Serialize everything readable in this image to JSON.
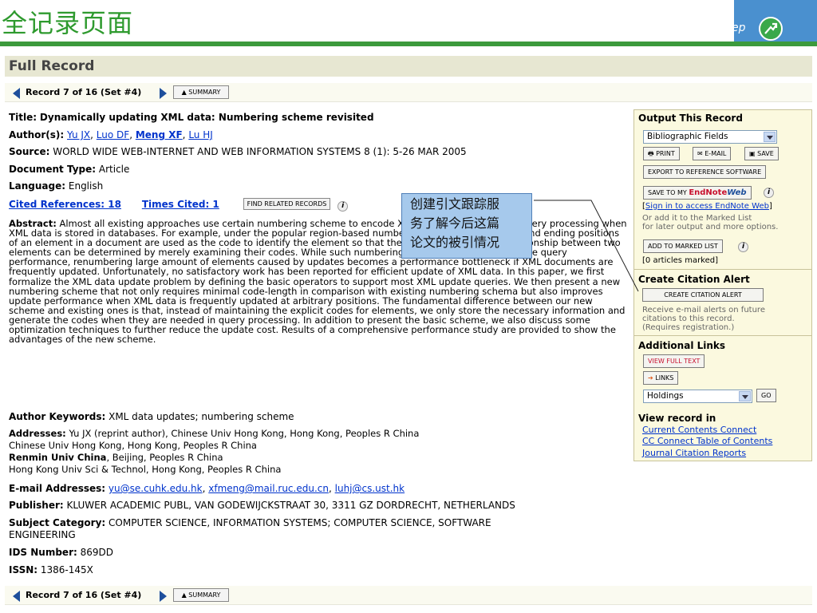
{
  "banner": {
    "title": "全记录页面",
    "step_text": "ep",
    "arrow_icon": "arrow-circle-icon",
    "colors": {
      "title": "#2e9a2e",
      "bar": "#3c9a3c",
      "right_panel": "#4a90cf"
    }
  },
  "header": {
    "title": "Full Record"
  },
  "record_nav": {
    "text": "Record 7 of 16 (Set #4)",
    "summary_label": "▲ SUMMARY"
  },
  "record": {
    "title_label": "Title:",
    "title": "Dynamically updating XML data: Numbering scheme revisited",
    "authors_label": "Author(s):",
    "authors": [
      "Yu JX",
      "Luo DF",
      "Meng XF",
      "Lu HJ"
    ],
    "source_label": "Source:",
    "source": "WORLD WIDE WEB-INTERNET AND WEB INFORMATION SYSTEMS 8 (1): 5-26 MAR 2005",
    "doctype_label": "Document Type:",
    "doctype": "Article",
    "language_label": "Language:",
    "language": "English",
    "cited_refs": "Cited References: 18",
    "times_cited": "Times Cited: 1",
    "find_related": "FIND RELATED RECORDS",
    "abstract_label": "Abstract:",
    "abstract": "Almost all existing approaches use certain numbering scheme to encode XML elements to facilitate query processing when XML data is stored in databases. For example, under the popular region-based numbering scheme, the starting and ending positions of an element in a document are used as the code to identify the element so that the ancestor/descendant relationship between two elements can be determined by merely examining their codes. While such numbering scheme can greatly improve query performance, renumbering large amount of elements caused by updates becomes a performance bottleneck if XML documents are frequently updated. Unfortunately, no satisfactory work has been reported for efficient update of XML data. In this paper, we first formalize the XML data update problem by defining the basic operators to support most XML update queries. We then present a new numbering scheme that not only requires minimal code-length in comparison with existing numbering schema but also improves update performance when XML data is frequently updated at arbitrary positions. The fundamental difference between our new scheme and existing ones is that, instead of maintaining the explicit codes for elements, we only store the necessary information and generate the codes when they are needed in query processing. In addition to present the basic scheme, we also discuss some optimization techniques to further reduce the update cost. Results of a comprehensive performance study are provided to show the advantages of the new scheme.",
    "keywords_label": "Author Keywords:",
    "keywords": "XML data updates; numbering scheme",
    "addresses_label": "Addresses:",
    "address_1": "Yu JX (reprint author), Chinese Univ Hong Kong, Hong Kong, Peoples R China",
    "address_2": "Chinese Univ Hong Kong, Hong Kong, Peoples R China",
    "address_3_bold": "Renmin Univ China",
    "address_3_rest": ", Beijing, Peoples R China",
    "address_4": "Hong Kong Univ Sci & Technol, Hong Kong, Peoples R China",
    "email_label": "E-mail Addresses:",
    "emails": [
      "yu@se.cuhk.edu.hk",
      "xfmeng@mail.ruc.edu.cn",
      "luhj@cs.ust.hk"
    ],
    "publisher_label": "Publisher:",
    "publisher": "KLUWER ACADEMIC PUBL, VAN GODEWIJCKSTRAAT 30, 3311 GZ DORDRECHT, NETHERLANDS",
    "subject_label": "Subject Category:",
    "subject_line1": "COMPUTER SCIENCE, INFORMATION SYSTEMS; COMPUTER SCIENCE, SOFTWARE",
    "subject_line2": "ENGINEERING",
    "ids_label": "IDS Number:",
    "ids": "869DD",
    "issn_label": "ISSN:",
    "issn": "1386-145X"
  },
  "callout": {
    "text_lines": [
      "创建引文跟踪服",
      "务了解今后这篇",
      "论文的被引情况"
    ]
  },
  "sidebar": {
    "output_title": "Output This Record",
    "fields_select": "Bibliographic Fields",
    "print": "PRINT",
    "email": "E-MAIL",
    "save": "SAVE",
    "export": "EXPORT TO REFERENCE SOFTWARE",
    "save_endnote_prefix": "SAVE TO MY ",
    "save_endnote_brand": "EndNote",
    "save_endnote_suffix": "Web",
    "sign_in_link": "Sign in to access EndNote Web",
    "marked_note_1": "Or add it to the Marked List",
    "marked_note_2": "for later output and more options.",
    "add_marked": "ADD TO MARKED LIST",
    "articles_marked": "[0 articles marked]",
    "alert_title": "Create Citation Alert",
    "alert_button": "CREATE CITATION ALERT",
    "alert_note_1": "Receive e-mail alerts on future",
    "alert_note_2": "citations to this record.",
    "alert_note_3": "(Requires registration.)",
    "links_title": "Additional Links",
    "full_text": "VIEW FULL TEXT",
    "links": "LINKS",
    "holdings_select": "Holdings",
    "go": "GO",
    "view_in_title": "View record in",
    "view_links": [
      "Current Contents Connect",
      "CC Connect Table of Contents",
      "Journal Citation Reports"
    ]
  }
}
